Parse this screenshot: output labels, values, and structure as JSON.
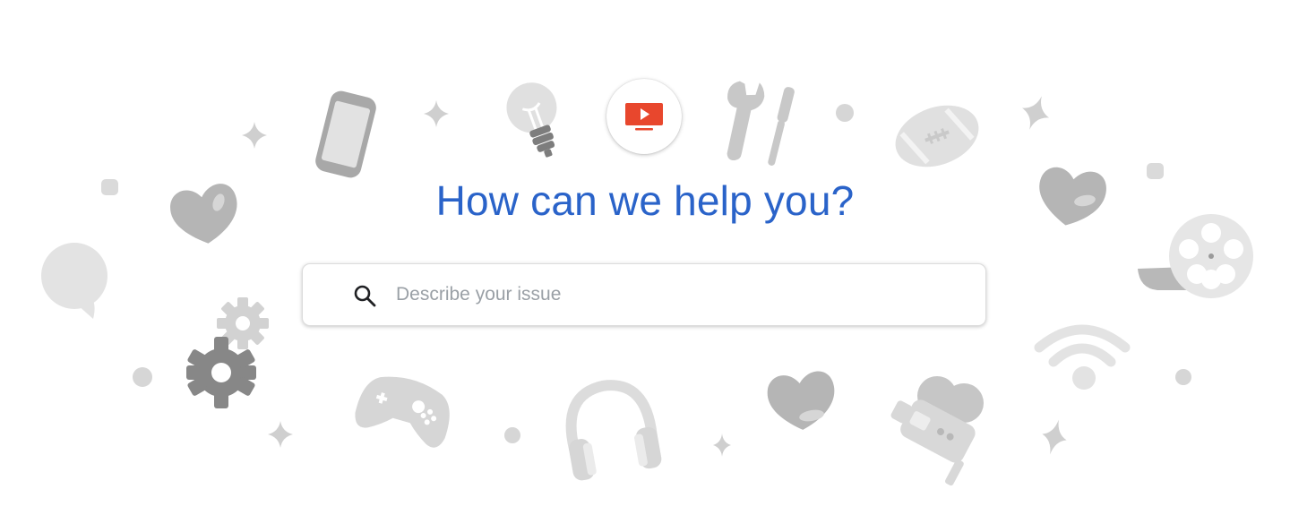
{
  "header": {
    "title": "How can we help you?"
  },
  "search": {
    "placeholder": "Describe your issue",
    "value": ""
  },
  "logo": {
    "icon": "youtube-tv-icon",
    "brand_color": "#e8472d"
  },
  "colors": {
    "headline": "#2a63c9",
    "decoration_light": "#e0e0e0",
    "decoration_mid": "#c2c2c2",
    "decoration_dark": "#8a8a8a"
  },
  "decorations": [
    "phone-icon",
    "lightbulb-icon",
    "wrench-screwdriver-icon",
    "football-icon",
    "heart-icon",
    "chat-bubble-icon",
    "gear-icon",
    "gamepad-icon",
    "headphones-icon",
    "video-camera-icon",
    "wifi-icon",
    "film-reel-icon",
    "sparkle-icon",
    "dot-icon"
  ]
}
